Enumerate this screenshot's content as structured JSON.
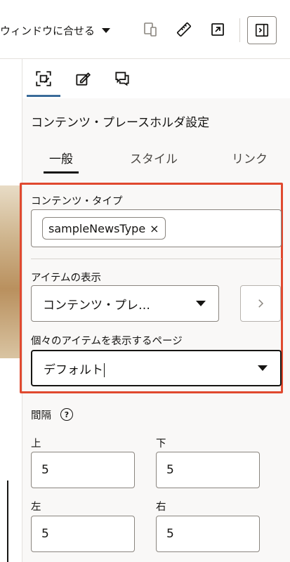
{
  "toolbar": {
    "fit_label": "ウィンドウに合せる",
    "icons": [
      "device-preview-icon",
      "ruler-icon",
      "open-external-icon",
      "panel-toggle-icon"
    ]
  },
  "panel": {
    "icon_tabs": [
      "content-placeholder-icon",
      "edit-settings-icon",
      "comments-icon"
    ],
    "title": "コンテンツ・プレースホルダ設定",
    "tabs": [
      {
        "label": "一般",
        "active": true
      },
      {
        "label": "スタイル",
        "active": false
      },
      {
        "label": "リンク",
        "active": false
      }
    ],
    "content_type": {
      "label": "コンテンツ・タイプ",
      "chip": "sampleNewsType",
      "chip_remove": "×"
    },
    "item_display": {
      "label": "アイテムの表示",
      "value": "コンテンツ・プレ…"
    },
    "item_page": {
      "label": "個々のアイテムを表示するページ",
      "value": "デフォルト"
    },
    "spacing": {
      "label": "間隔",
      "help": "?",
      "top_label": "上",
      "top_value": "5",
      "bottom_label": "下",
      "bottom_value": "5",
      "left_label": "左",
      "left_value": "5",
      "right_label": "右",
      "right_value": "5"
    }
  },
  "colors": {
    "highlight": "#e0492f",
    "accent": "#3a6b99"
  }
}
